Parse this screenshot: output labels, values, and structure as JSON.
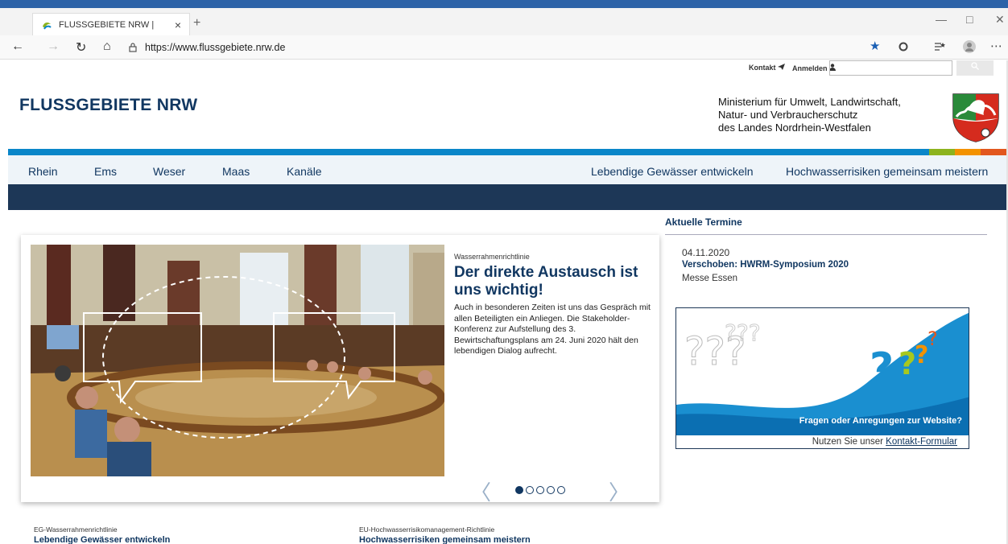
{
  "browser": {
    "tab_title": "FLUSSGEBIETE NRW |",
    "tab_close": "×",
    "new_tab": "+",
    "url": "https://www.flussgebiete.nrw.de",
    "controls": {
      "back": "←",
      "forward": "→",
      "reload": "↻",
      "home": "⌂",
      "lock": "🔒",
      "minimize": "—",
      "maximize": "□",
      "close": "✕",
      "star": "★",
      "more": "⋯"
    }
  },
  "utility": {
    "contact": "Kontakt",
    "login": "Anmelden",
    "search_button": "Suche"
  },
  "header": {
    "brand": "FLUSSGEBIETE NRW",
    "ministry_lines": [
      "Ministerium für Umwelt, Landwirtschaft,",
      "Natur- und Verbraucherschutz",
      "des Landes Nordrhein-Westfalen"
    ]
  },
  "nav": {
    "left": [
      "Rhein",
      "Ems",
      "Weser",
      "Maas",
      "Kanäle"
    ],
    "right": [
      "Lebendige Gewässer entwickeln",
      "Hochwasserrisiken gemeinsam meistern"
    ]
  },
  "colors": {
    "brand": "#113761",
    "blue_bar": "#0a86c9",
    "dark_strip": "#1d3757",
    "accent_green": "#8cb31e",
    "accent_orange": "#f39200",
    "accent_red": "#e2571e"
  },
  "carousel": {
    "kicker": "Wasserrahmenrichtlinie",
    "headline": "Der direkte Austausch ist uns wichtig!",
    "teaser": "Auch in besonderen Zeiten ist uns das Gespräch mit allen Beteiligten ein Anliegen. Die Stakeholder-Konferenz zur Aufstellung des 3. Bewirtschaftungsplans am 24. Juni 2020 hält den lebendigen Dialog aufrecht.",
    "prev": "〈",
    "next": "〉",
    "slide_count": 5,
    "active_slide": 1
  },
  "termine": {
    "heading": "Aktuelle Termine",
    "date": "04.11.2020",
    "title": "Verschoben: HWRM-Symposium 2020",
    "place": "Messe Essen"
  },
  "promo": {
    "title": "Fragen oder Anregungen zur Website?",
    "foot_prefix": "Nutzen Sie unser ",
    "foot_link": "Kontakt-Formular"
  },
  "bottom": [
    {
      "kicker": "EG-Wasserrahmenrichtlinie",
      "heading": "Lebendige Gewässer entwickeln"
    },
    {
      "kicker": "EU-Hochwasserrisikomanagement-Richtlinie",
      "heading": "Hochwasserrisiken gemeinsam meistern"
    }
  ]
}
